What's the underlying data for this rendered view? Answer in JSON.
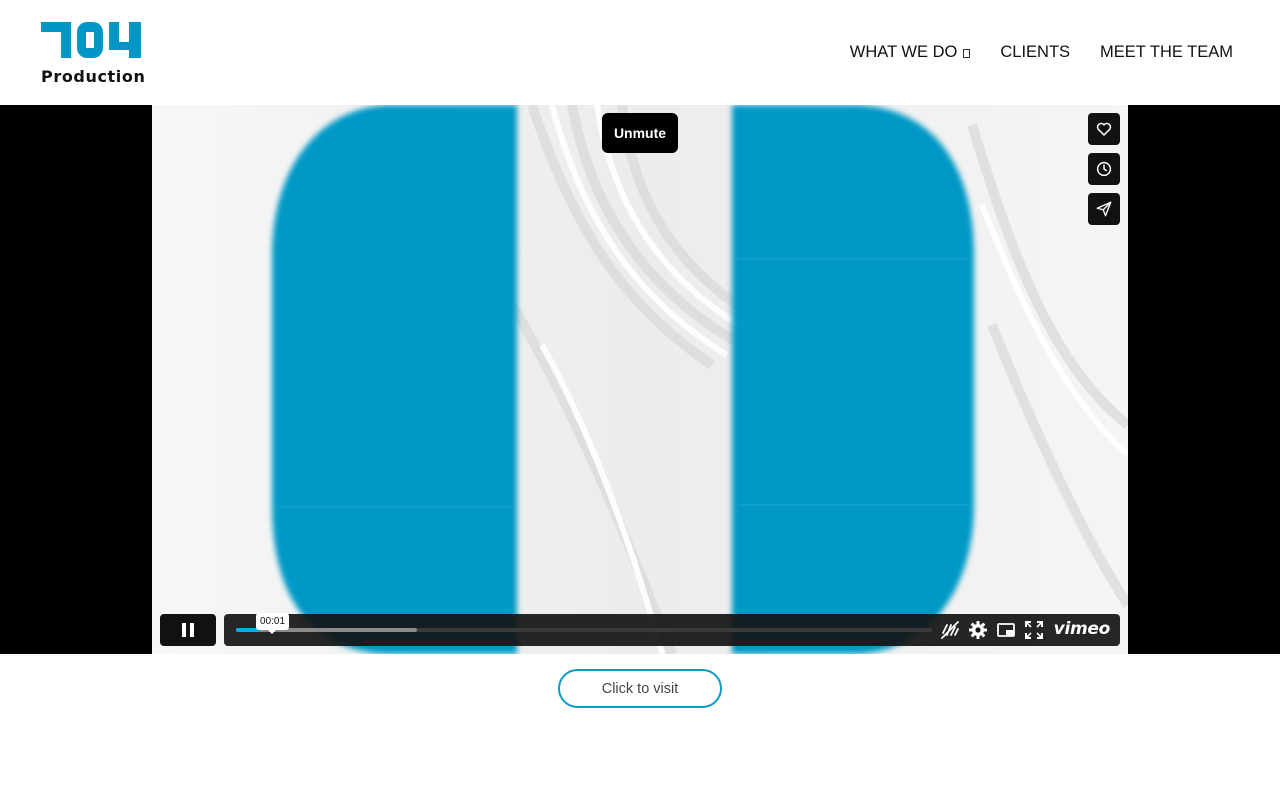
{
  "brand": {
    "wordmark": "Production",
    "accent_color": "#0096c6"
  },
  "nav": {
    "items": [
      {
        "label": "WHAT WE DO",
        "has_dropdown": true
      },
      {
        "label": "CLIENTS"
      },
      {
        "label": "MEET THE TEAM"
      }
    ]
  },
  "player": {
    "unmute_label": "Unmute",
    "side_buttons": [
      "heart-icon",
      "clock-icon",
      "send-icon"
    ],
    "current_time": "00:01",
    "progress_played": 0.035,
    "progress_buffered": 0.26,
    "state": "playing",
    "control_icons": [
      "captions-off-icon",
      "settings-gear-icon",
      "picture-in-picture-icon",
      "fullscreen-icon"
    ],
    "provider_logo": "vimeo",
    "progress_color": "#00adef"
  },
  "cta": {
    "visit_label": "Click to visit"
  }
}
